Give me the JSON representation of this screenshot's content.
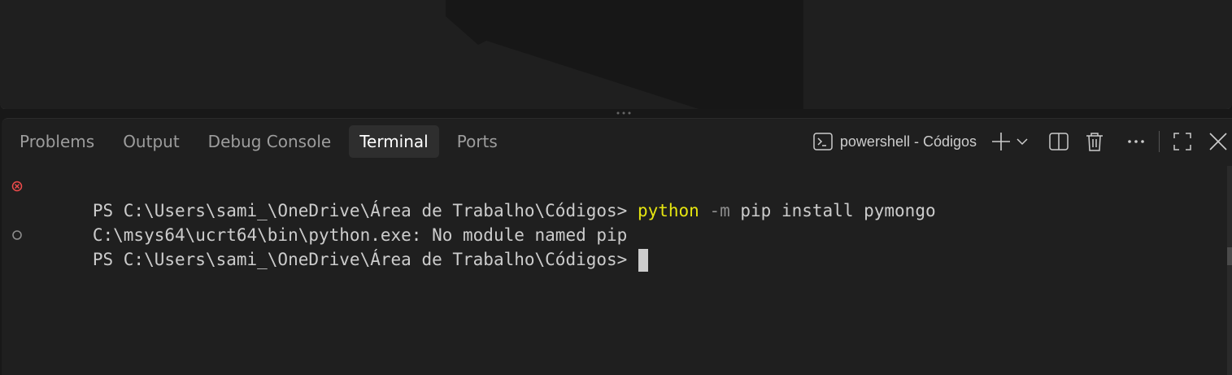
{
  "panel": {
    "tabs": [
      {
        "label": "Problems"
      },
      {
        "label": "Output"
      },
      {
        "label": "Debug Console"
      },
      {
        "label": "Terminal"
      },
      {
        "label": "Ports"
      }
    ],
    "active_tab": "Terminal"
  },
  "terminal_selector": {
    "label": "powershell - Códigos",
    "icon": "terminal-icon"
  },
  "actions": {
    "icons": [
      "plus-icon",
      "chevron-down-icon",
      "split-icon",
      "trash-icon",
      "more-icon",
      "maximize-icon",
      "close-icon"
    ]
  },
  "terminal": {
    "line1": {
      "prompt": "PS C:\\Users\\sami_\\OneDrive\\Área de Trabalho\\Códigos> ",
      "exe": "python",
      "flag": " -m",
      "rest": " pip install pymongo",
      "status": "error"
    },
    "line2": {
      "text": "C:\\msys64\\ucrt64\\bin\\python.exe: No module named pip"
    },
    "line3": {
      "prompt": "PS C:\\Users\\sami_\\OneDrive\\Área de Trabalho\\Códigos>",
      "status": "pending"
    }
  },
  "colors": {
    "background": "#1f1f1f",
    "command": "#e5e510",
    "error": "#f14c4c",
    "text": "#cccccc"
  }
}
